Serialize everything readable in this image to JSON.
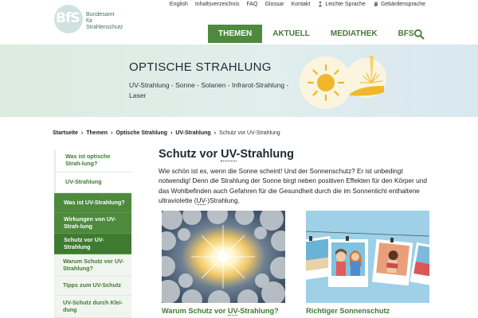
{
  "logo": {
    "mark": "BfS",
    "line1": "Bundesamt",
    "line2": "für Strahlenschutz"
  },
  "meta_nav": [
    {
      "label": "English",
      "icon": ""
    },
    {
      "label": "Inhaltsverzeichnis",
      "icon": ""
    },
    {
      "label": "FAQ",
      "icon": ""
    },
    {
      "label": "Glossar",
      "icon": ""
    },
    {
      "label": "Kontakt",
      "icon": ""
    },
    {
      "label": "Leichte Sprache",
      "icon": "easy-language-icon"
    },
    {
      "label": "Gebärdensprache",
      "icon": "sign-language-icon"
    }
  ],
  "main_nav": [
    {
      "label": "THEMEN",
      "active": true
    },
    {
      "label": "AKTUELL",
      "active": false
    },
    {
      "label": "MEDIATHEK",
      "active": false
    },
    {
      "label": "BFS",
      "active": false
    }
  ],
  "banner": {
    "title": "OPTISCHE STRAHLUNG",
    "subtitle": "UV-Strahlung - Sonne - Solarien - Infrarot-Strahlung - Laser"
  },
  "breadcrumb": [
    "Startseite",
    "Themen",
    "Optische Strahlung",
    "UV-Strahlung",
    "Schutz vor UV-Strahlung"
  ],
  "sidebar": [
    {
      "label": "Was ist optische Strah-lung?",
      "level": 1,
      "active": false,
      "height": 29
    },
    {
      "label": "UV-Strahlung",
      "level": 1,
      "active": false,
      "height": 26
    },
    {
      "label": "Was ist UV-Strahlung?",
      "level": 2,
      "active": false,
      "height": 25
    },
    {
      "label": "Wirkungen von UV-Strah-lung",
      "level": 2,
      "active": false,
      "height": 26
    },
    {
      "label": "Schutz vor UV-Strahlung",
      "level": 2,
      "active": true,
      "height": 26
    },
    {
      "label": "Warum Schutz vor UV-Strahlung?",
      "level": 3,
      "active": false,
      "height": 28
    },
    {
      "label": "Tipps zum UV-Schutz",
      "level": 3,
      "active": false,
      "height": 24
    },
    {
      "label": "UV-Schutz durch Klei-dung",
      "level": 3,
      "active": false,
      "height": 28
    }
  ],
  "content": {
    "title_pre": "Schutz vor ",
    "title_abbr": "UV",
    "title_post": "-Strahlung",
    "intro_pre": "Wie schön ist es, wenn die Sonne scheint! Und der Sonnenschutz? Er ist unbedingt notwendig! Denn die Strahlung der Sonne birgt neben positiven Effekten für den Körper und das Wohlbefinden auch Gefahren für die Gesundheit durch die im Sonnenlicht enthaltene ultraviolette (",
    "intro_abbr": "UV",
    "intro_post": "-)Strahlung."
  },
  "cards": [
    {
      "title_pre": "Warum Schutz vor ",
      "title_abbr": "UV",
      "title_post": "-Strahlung?",
      "image": "sun-through-clouds"
    },
    {
      "title_pre": "Richtiger Sonnenschutz",
      "title_abbr": "",
      "title_post": "",
      "image": "holiday-photos"
    }
  ],
  "colors": {
    "brand_green": "#4d8a3d",
    "link_green": "#3f7a2f",
    "banner_start": "#dcecde",
    "banner_end": "#d9e7f1"
  }
}
